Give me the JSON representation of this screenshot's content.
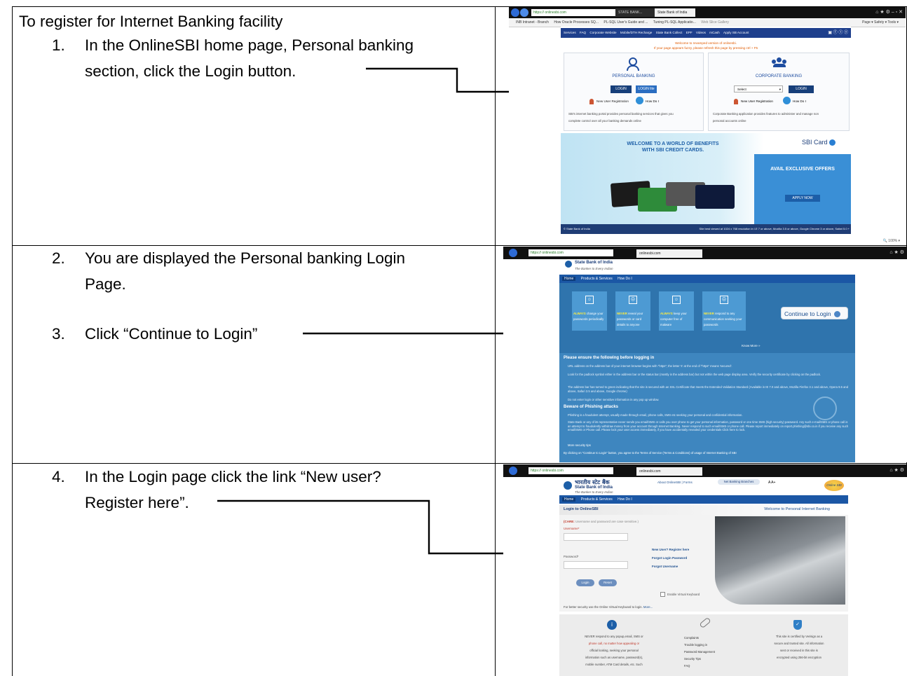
{
  "intro": {
    "heading": "To register for Internet Banking facility"
  },
  "steps": [
    {
      "number": "1.",
      "lines": [
        "In the OnlineSBI home page, Personal banking",
        "section, click the Login button."
      ]
    },
    {
      "number": "2.",
      "lines": [
        "You are displayed the Personal banking Login",
        "Page."
      ]
    },
    {
      "number": "3.",
      "lines": [
        "Click “Continue to Login”"
      ]
    },
    {
      "number": "4.",
      "lines": [
        "In the Login page click the link “New user?",
        "Register here”."
      ]
    }
  ],
  "shot1": {
    "address": "https://           onlinesbi.com",
    "tabs": [
      "STATE BANK...",
      "State Bank of India"
    ],
    "favorites": [
      "INB Intranet - Branch",
      "How Oracle Processes SQ...",
      "PL-SQL User's Guide and ...",
      "Tuning PL-SQL Applicatio...",
      "Web Slice Gallery"
    ],
    "tools": "Page ▾  Safety ▾  Tools ▾",
    "menu": [
      "Services",
      "FAQ",
      "Corporate Website",
      "Mobile/DTH Recharge",
      "State Bank Collect",
      "EPF",
      "Videos",
      "mCash",
      "Apply SB Account"
    ],
    "welcome": "Welcome to revamped version of onlinesbi.",
    "refresh_note": "If your page appears fuzzy, please refresh this page by pressing ctrl + F5",
    "personal": {
      "title": "PERSONAL BANKING",
      "login": "LOGIN",
      "login_lite": "LOGIN lite",
      "new_user": "New User Registration",
      "how_do_i": "How Do I",
      "desc": [
        "SBI's internet banking portal provides personal banking services that gives you",
        "complete control over all your banking demands online"
      ]
    },
    "corporate": {
      "title": "CORPORATE BANKING",
      "select": "Select",
      "login": "LOGIN",
      "new_user": "New User Registration",
      "how_do_i": "How Do I",
      "desc": [
        "Corporate Banking application provides features to administer and manage non",
        "personal accounts online"
      ]
    },
    "banner": {
      "headline1": "WELCOME TO A WORLD OF BENEFITS",
      "headline2": "WITH SBI CREDIT CARDS.",
      "brand": "SBI Card",
      "offer": "AVAIL EXCLUSIVE OFFERS",
      "apply": "APPLY NOW"
    },
    "footer_left": "© State Bank of India",
    "footer_right": "Site best viewed at 1024 x 768 resolution in I.E 7 or above, Mozilla 3.5 or above, Google Chrome 3 or above, Safari 5.0 +",
    "zoom": "100%"
  },
  "shot2": {
    "address": "https://           onlinesbi.com",
    "tab": "onlinesbi.com",
    "bank_name": "State Bank of India",
    "tagline": "The Banker to Every Indian",
    "nav": [
      "Home",
      "Products & Services",
      "How Do I"
    ],
    "tips": [
      {
        "label": "ALWAYS",
        "text": "change your passwords periodically"
      },
      {
        "label": "NEVER",
        "text": "reveal your passwords or card details to anyone"
      },
      {
        "label": "ALWAYS",
        "text": "keep your computer free of malware"
      },
      {
        "label": "NEVER",
        "text": "respond to any communication seeking your passwords"
      }
    ],
    "continue_button": "Continue to Login",
    "know_more": "Know More",
    "ensure_heading": "Please ensure the following before logging in",
    "ensure_items": [
      "URL address on the address bar of your internet browser begins with \"https\"; the letter 's' at the end of \"https\" means 'secured'.",
      "Look for the padlock symbol either in the address bar or the status bar (mostly in the address bar) but not within the web page display area. Verify the security certificate by clicking on the padlock.",
      "The address bar has turned to green indicating that the site is secured with an SSL Certificate that meets the Extended Validation Standard (Available in IE 7.0 and above, Mozilla Firefox 3.1 and above, Opera 9.5 and above, Safari 3.5 and above, Google chrome)",
      "Do not enter login or other sensitive information in any pop up window."
    ],
    "phishing_heading": "Beware of Phishing attacks",
    "phishing_items": [
      "Phishing is a fraudulent attempt, usually made through email, phone calls, SMS etc seeking your personal and confidential information.",
      "State Bank or any of its representative never sends you email/SMS or calls you over phone to get your personal information, password or one time SMS (high security) password. Any such e-mail/SMS or phone call is an attempt to fraudulently withdraw money from your account through Internet Banking. Never respond to such email/SMS or phone call. Please report immediately on report.phishing@sbi.co.in if you receive any such email/SMS or Phone call. Please lock your user access immediately, if you have accidentally revealed your credentials Click here to lock.",
      "More security tips"
    ],
    "terms": "By clicking on \"Continue to Login\" button, you agree to the Terms of Service (Terms & Conditions) of usage of Internet Banking of SBI"
  },
  "shot3": {
    "address": "https://           onlinesbi.com",
    "tab": "onlinesbi.com",
    "bank_hindi": "भारतीय स्टेट बैंक",
    "bank_name": "State Bank of India",
    "tagline": "The Banker to Every Indian",
    "top_links": [
      "About OnlineSBI",
      "Forms"
    ],
    "netbanking": "Net Banking Branches",
    "font_sizes": "A  A+",
    "logo": "Online SBI",
    "nav": [
      "Home",
      "Products & Services",
      "How Do I"
    ],
    "login_title": "Login to OnlineSBI",
    "welcome": "Welcome to Personal Internet Banking",
    "care_label": "(CARE:",
    "care_text": "Username and password are case sensitive.)",
    "username_label": "Username*",
    "password_label": "Password*",
    "links": [
      "New User? Register here",
      "Forgot Login Password",
      "Forgot Username"
    ],
    "login_btn": "Login",
    "reset_btn": "Reset",
    "virtual_kb": "Enable Virtual Keyboard",
    "security_note": "For better security use the Online Virtual Keyboard to login.",
    "more": "More...",
    "col1": [
      "NEVER respond to any popup,email, SMS or",
      "phone call, no matter how appealing or",
      "official looking, seeking your personal",
      "information such as username, password(s),",
      "mobile number, ATM Card details, etc. Such"
    ],
    "col2": [
      "Complaints",
      "Trouble logging in",
      "Password Management",
      "Security Tips",
      "FAQ"
    ],
    "col3": [
      "This site is certified by Verisign as a",
      "secure and trusted site. All information",
      "sent or received in this site is",
      "encrypted using 256-bit encryption"
    ]
  }
}
